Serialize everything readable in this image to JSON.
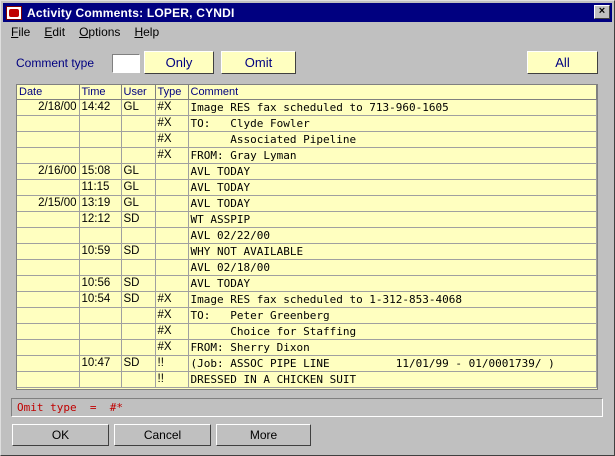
{
  "window": {
    "title": "Activity Comments:  LOPER, CYNDI",
    "close_glyph": "×"
  },
  "menu": [
    {
      "underline": "F",
      "rest": "ile"
    },
    {
      "underline": "E",
      "rest": "dit"
    },
    {
      "underline": "O",
      "rest": "ptions"
    },
    {
      "underline": "H",
      "rest": "elp"
    }
  ],
  "filter": {
    "label": "Comment type",
    "value": "",
    "only_label": "Only",
    "omit_label": "Omit",
    "all_label": "All"
  },
  "table": {
    "headers": [
      "Date",
      "Time",
      "User",
      "Type",
      "Comment"
    ],
    "rows": [
      [
        "2/18/00",
        "14:42",
        "GL",
        "#X",
        "Image RES fax scheduled to 713-960-1605"
      ],
      [
        "",
        "",
        "",
        "#X",
        "TO:   Clyde Fowler"
      ],
      [
        "",
        "",
        "",
        "#X",
        "      Associated Pipeline"
      ],
      [
        "",
        "",
        "",
        "#X",
        "FROM: Gray Lyman"
      ],
      [
        "2/16/00",
        "15:08",
        "GL",
        "",
        "AVL TODAY"
      ],
      [
        "",
        "11:15",
        "GL",
        "",
        "AVL TODAY"
      ],
      [
        "2/15/00",
        "13:19",
        "GL",
        "",
        "AVL TODAY"
      ],
      [
        "",
        "12:12",
        "SD",
        "",
        "WT ASSPIP"
      ],
      [
        "",
        "",
        "",
        "",
        "AVL 02/22/00"
      ],
      [
        "",
        "10:59",
        "SD",
        "",
        "WHY NOT AVAILABLE"
      ],
      [
        "",
        "",
        "",
        "",
        "AVL 02/18/00"
      ],
      [
        "",
        "10:56",
        "SD",
        "",
        "AVL TODAY"
      ],
      [
        "",
        "10:54",
        "SD",
        "#X",
        "Image RES fax scheduled to 1-312-853-4068"
      ],
      [
        "",
        "",
        "",
        "#X",
        "TO:   Peter Greenberg"
      ],
      [
        "",
        "",
        "",
        "#X",
        "      Choice for Staffing"
      ],
      [
        "",
        "",
        "",
        "#X",
        "FROM: Sherry Dixon"
      ],
      [
        "",
        "10:47",
        "SD",
        "!!",
        "(Job: ASSOC PIPE LINE          11/01/99 - 01/0001739/ )"
      ],
      [
        "",
        "",
        "",
        "!!",
        "DRESSED IN A CHICKEN SUIT"
      ]
    ]
  },
  "status": {
    "text": "Omit type  =  #*"
  },
  "buttons": {
    "ok": "OK",
    "cancel": "Cancel",
    "more": "More"
  }
}
